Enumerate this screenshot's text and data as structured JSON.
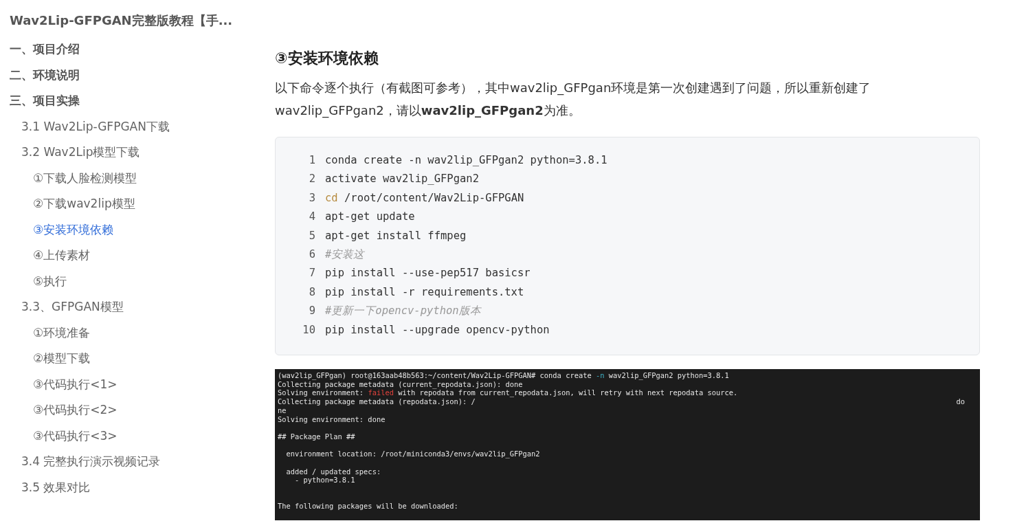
{
  "toc": {
    "title": "Wav2Lip-GFPGAN完整版教程【手...",
    "items": [
      {
        "label": "一、项目介绍",
        "selected": false
      },
      {
        "label": "二、环境说明",
        "selected": false
      },
      {
        "label": "三、项目实操",
        "selected": false,
        "children": [
          {
            "label": "3.1 Wav2Lip-GFPGAN下载",
            "selected": false
          },
          {
            "label": "3.2 Wav2Lip模型下载",
            "selected": false,
            "children": [
              {
                "label": "①下载人脸检测模型",
                "selected": false
              },
              {
                "label": "②下载wav2lip模型",
                "selected": false
              },
              {
                "label": "③安装环境依赖",
                "selected": true
              },
              {
                "label": "④上传素材",
                "selected": false
              },
              {
                "label": "⑤执行",
                "selected": false
              }
            ]
          },
          {
            "label": "3.3、GFPGAN模型",
            "selected": false,
            "children": [
              {
                "label": "①环境准备",
                "selected": false
              },
              {
                "label": "②模型下载",
                "selected": false
              },
              {
                "label": "③代码执行<1>",
                "selected": false
              },
              {
                "label": "③代码执行<2>",
                "selected": false
              },
              {
                "label": "③代码执行<3>",
                "selected": false
              }
            ]
          },
          {
            "label": "3.4 完整执行演示视频记录",
            "selected": false
          },
          {
            "label": "3.5 效果对比",
            "selected": false
          }
        ]
      }
    ]
  },
  "article": {
    "heading": "③安装环境依赖",
    "paragraph": "以下命令逐个执行（有截图可参考），其中wav2lip_GFPgan环境是第一次创建遇到了问题，所以重新创建了wav2lip_GFPgan2，请以**wav2lip_GFPgan2**为准。",
    "code": [
      {
        "number": "1",
        "segments": [
          {
            "kind": "plain",
            "text": "conda create -n wav2lip_GFPgan2 python=3.8.1"
          }
        ]
      },
      {
        "number": "2",
        "segments": [
          {
            "kind": "plain",
            "text": "activate wav2lip_GFPgan2"
          }
        ]
      },
      {
        "number": "3",
        "segments": [
          {
            "kind": "keyword",
            "text": "cd"
          },
          {
            "kind": "plain",
            "text": " /root/content/Wav2Lip-GFPGAN"
          }
        ]
      },
      {
        "number": "4",
        "segments": [
          {
            "kind": "plain",
            "text": "apt-get update"
          }
        ]
      },
      {
        "number": "5",
        "segments": [
          {
            "kind": "plain",
            "text": "apt-get install ffmpeg"
          }
        ]
      },
      {
        "number": "6",
        "segments": [
          {
            "kind": "comment",
            "text": "#安装这"
          }
        ]
      },
      {
        "number": "7",
        "segments": [
          {
            "kind": "plain",
            "text": "pip install --use-pep517 basicsr"
          }
        ]
      },
      {
        "number": "8",
        "segments": [
          {
            "kind": "plain",
            "text": "pip install -r requirements.txt"
          }
        ]
      },
      {
        "number": "9",
        "segments": [
          {
            "kind": "comment",
            "text": "#更新一下opencv-python版本"
          }
        ]
      },
      {
        "number": "10",
        "segments": [
          {
            "kind": "plain",
            "text": "pip install --upgrade opencv-python"
          }
        ]
      }
    ],
    "terminal": [
      {
        "kind": "text",
        "segments": [
          {
            "kind": "plain",
            "text": "(wav2lip_GFPgan) root@163aab48b563:~/content/Wav2Lip-GFPGAN# conda create "
          },
          {
            "kind": "option",
            "text": "-n"
          },
          {
            "kind": "plain",
            "text": " wav2lip_GFPgan2 python=3.8.1"
          }
        ]
      },
      {
        "kind": "text",
        "segments": [
          {
            "kind": "plain",
            "text": "Collecting package metadata (current_repodata.json): done"
          }
        ]
      },
      {
        "kind": "text",
        "segments": [
          {
            "kind": "plain",
            "text": "Solving environment: "
          },
          {
            "kind": "error",
            "text": "failed"
          },
          {
            "kind": "plain",
            "text": " with repodata from current_repodata.json, will retry with next repodata source."
          }
        ]
      },
      {
        "kind": "text",
        "segments": [
          {
            "kind": "plain",
            "text": "Collecting package metadata (repodata.json): /"
          },
          {
            "kind": "right",
            "text": "do"
          }
        ]
      },
      {
        "kind": "text",
        "segments": [
          {
            "kind": "plain",
            "text": "ne"
          }
        ]
      },
      {
        "kind": "text",
        "segments": [
          {
            "kind": "plain",
            "text": "Solving environment: done"
          }
        ]
      },
      {
        "kind": "blank"
      },
      {
        "kind": "text",
        "segments": [
          {
            "kind": "plain",
            "text": "## Package Plan ##"
          }
        ]
      },
      {
        "kind": "blank"
      },
      {
        "kind": "text",
        "segments": [
          {
            "kind": "plain",
            "text": "  environment location: /root/miniconda3/envs/wav2lip_GFPgan2"
          }
        ]
      },
      {
        "kind": "blank"
      },
      {
        "kind": "text",
        "segments": [
          {
            "kind": "plain",
            "text": "  added / updated specs:"
          }
        ]
      },
      {
        "kind": "text",
        "segments": [
          {
            "kind": "plain",
            "text": "    - python=3.8.1"
          }
        ]
      },
      {
        "kind": "blank"
      },
      {
        "kind": "blank"
      },
      {
        "kind": "text",
        "segments": [
          {
            "kind": "plain",
            "text": "The following packages will be downloaded:"
          }
        ]
      }
    ]
  }
}
